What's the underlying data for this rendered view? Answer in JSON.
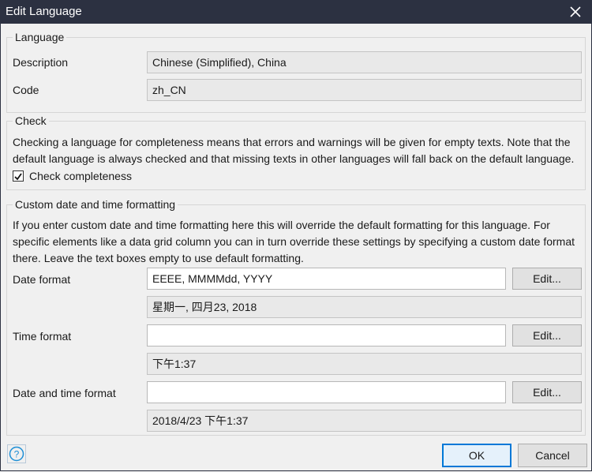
{
  "window": {
    "title": "Edit Language",
    "close_icon": "close-icon"
  },
  "language_group": {
    "legend": "Language",
    "description_label": "Description",
    "description_value": "Chinese (Simplified), China",
    "code_label": "Code",
    "code_value": "zh_CN"
  },
  "check_group": {
    "legend": "Check",
    "text": "Checking a language for completeness means that errors and warnings will be given for empty texts. Note that the default language is always checked and that missing texts in other languages will fall back on the default language.",
    "checkbox_label": "Check completeness",
    "checked": true
  },
  "format_group": {
    "legend": "Custom date and time formatting",
    "text": "If you enter custom date and time formatting here this will override the default formatting for this language. For specific elements like a data grid column you can in turn override these settings by specifying a custom date format there. Leave the text boxes empty to use default formatting.",
    "date_label": "Date format",
    "date_value": "EEEE, MMMMdd, YYYY",
    "date_preview": "星期一, 四月23, 2018",
    "time_label": "Time format",
    "time_value": "",
    "time_preview": "下午1:37",
    "datetime_label": "Date and time format",
    "datetime_value": "",
    "datetime_preview": "2018/4/23 下午1:37",
    "edit_label": "Edit..."
  },
  "footer": {
    "help_icon": "help-icon",
    "ok_label": "OK",
    "cancel_label": "Cancel"
  },
  "colors": {
    "titlebar": "#2c3141",
    "accent": "#0078d7",
    "help": "#1e8fd6"
  }
}
